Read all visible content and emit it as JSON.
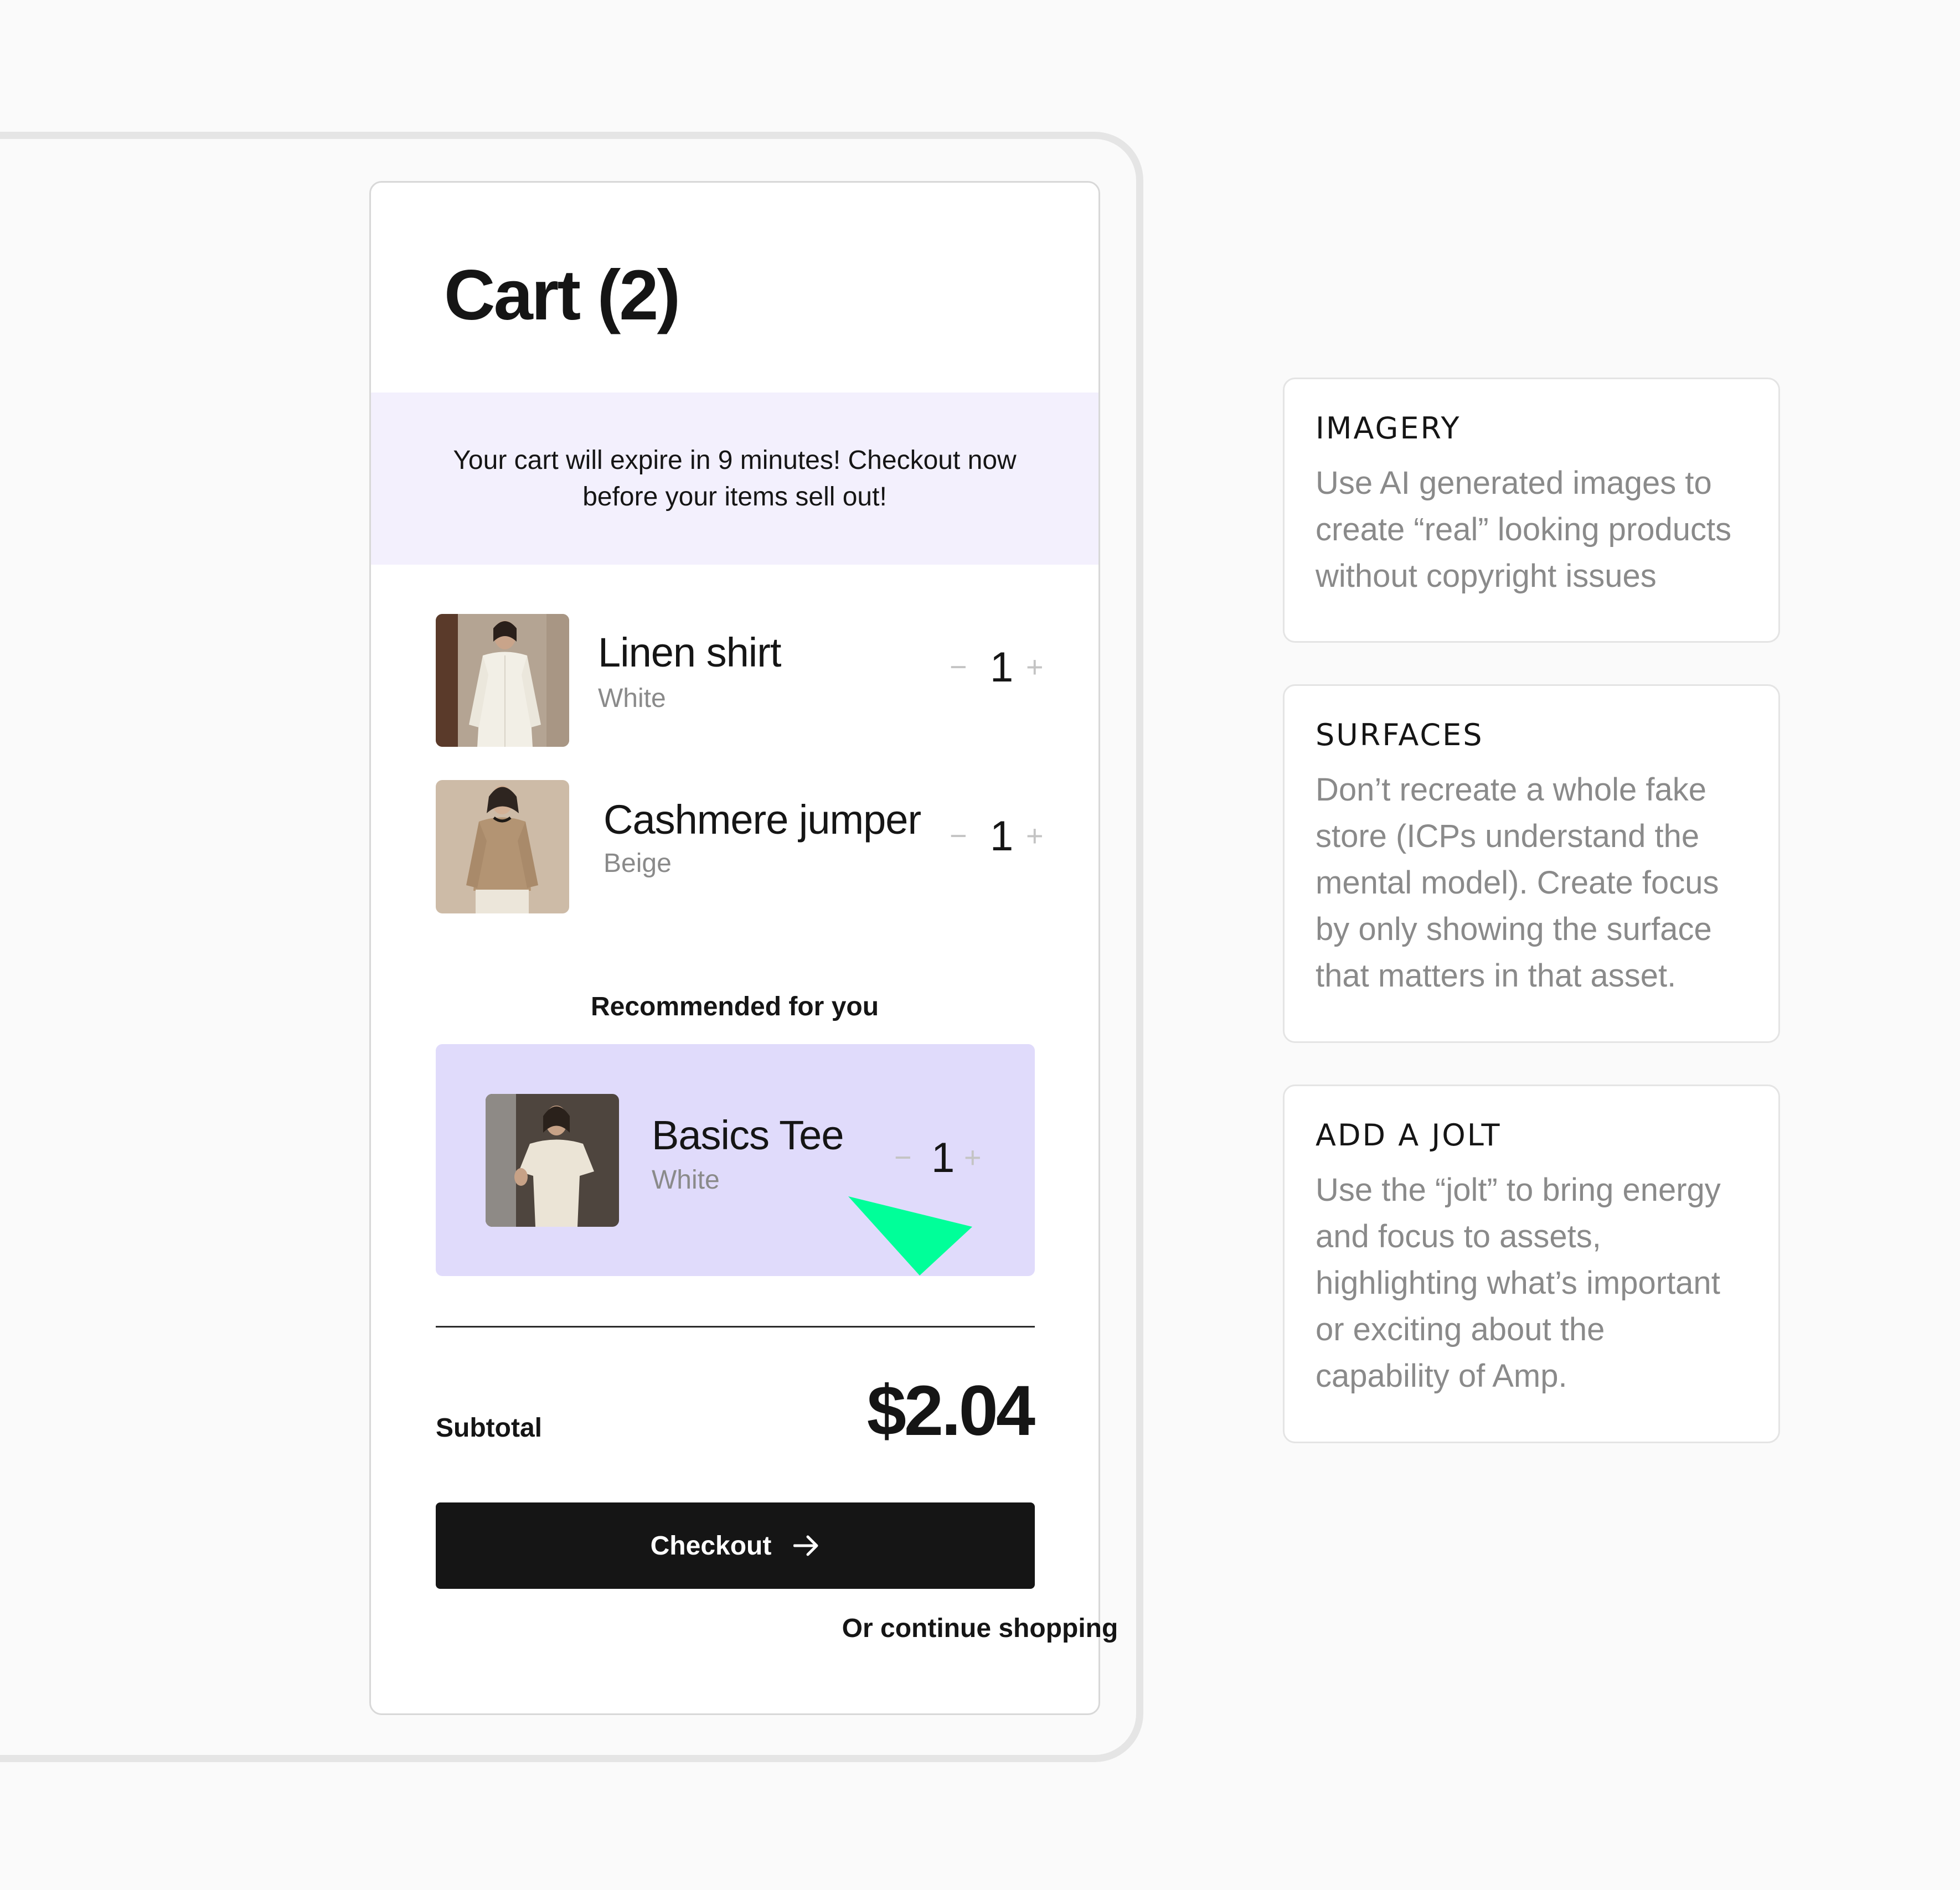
{
  "cart": {
    "title": "Cart (2)",
    "banner": "Your cart will expire in 9 minutes! Checkout now before your items sell out!",
    "items": [
      {
        "name": "Linen shirt",
        "color": "White",
        "qty": "1"
      },
      {
        "name": "Cashmere jumper",
        "color": "Beige",
        "qty": "1"
      }
    ],
    "recommended": {
      "title": "Recommended for you",
      "item": {
        "name": "Basics Tee",
        "color": "White",
        "qty": "1"
      }
    },
    "subtotal_label": "Subtotal",
    "subtotal_value": "$2.04",
    "checkout_label": "Checkout",
    "continue_label": "Or continue shopping"
  },
  "notes": [
    {
      "title": "IMAGERY",
      "body": "Use AI generated images to create “real” looking products without copyright issues"
    },
    {
      "title": "SURFACES",
      "body": "Don’t recreate a whole fake store (ICPs understand the mental model). Create focus by only showing the surface that matters in that asset."
    },
    {
      "title": "ADD A JOLT",
      "body": "Use the “jolt” to bring energy and focus to assets, highlighting what’s important or exciting about the capability of Amp."
    }
  ],
  "colors": {
    "banner_bg": "#f3f0fd",
    "recommended_bg": "#e0dbfb",
    "jolt_accent": "#00ff99",
    "button_bg": "#151515"
  }
}
